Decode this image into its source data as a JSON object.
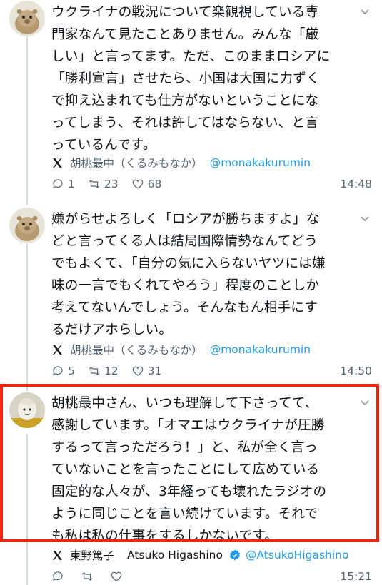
{
  "tweets": [
    {
      "avatar": "capybara-avatar",
      "body": "ウクライナの戦況について楽観視している専\n門家なんて見たことありません。みんな「厳\nしい」と言ってます。ただ、このままロシアに\n「勝利宣言」させたら、小国は大国に力ずく\nで抑え込まれても仕方がないということにな\nってしまう、それは許してはならない、と言\nっているんです。",
      "source_name": "胡桃最中（くるみもなか）",
      "handle": "@monakakurumin",
      "replies": "1",
      "retweets": "23",
      "likes": "68",
      "time": "14:48"
    },
    {
      "avatar": "capybara-avatar",
      "body": "嫌がらせよろしく「ロシアが勝ちますよ」な\nどと言ってくる人は結局国際情勢なんてどう\nでもよくて、「自分の気に入らないヤツには嫌\n味の一言でもくれてやろう」程度のことしか\n考えてないんでしょう。そんなもん相手にす\nるだけアホらしい。",
      "source_name": "胡桃最中（くるみもなか）",
      "handle": "@monakakurumin",
      "replies": "5",
      "retweets": "12",
      "likes": "31",
      "time": "14:50"
    },
    {
      "avatar": "figure-avatar",
      "body": "胡桃最中さん、いつも理解して下さってて、\n感謝しています。「オマエはウクライナが圧勝\nするって言っただろう！」と、私が全く言っ\nていないことを言ったことにして広めている\n固定的な人々が、3年経っても壊れたラジオの\nように同じことを言い続けています。それで\nも私は私の仕事をするしかないです。",
      "source_name": "東野篤子",
      "source_name_latin": "Atsuko Higashino",
      "handle": "@AtsukoHigashino",
      "replies": "",
      "retweets": "",
      "likes": "",
      "time": "15:21"
    }
  ],
  "colors": {
    "link": "#1d9bf0",
    "muted": "#536471",
    "highlight": "#f0260f",
    "verified": "#1d9bf0"
  }
}
